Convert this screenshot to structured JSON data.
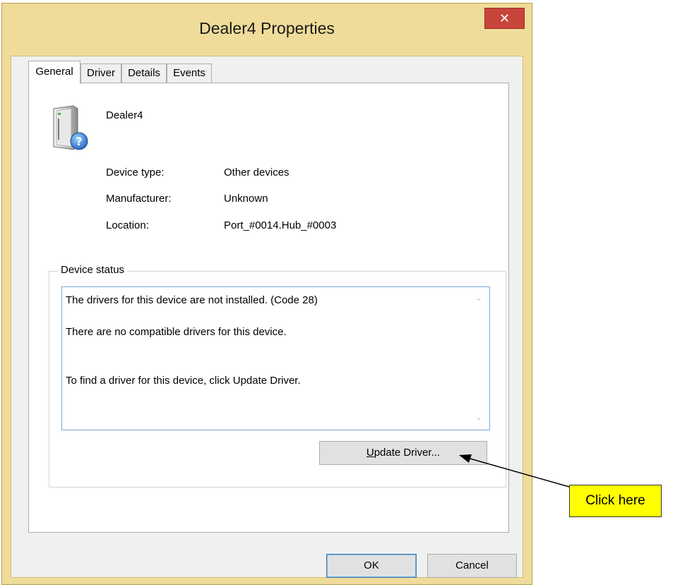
{
  "window": {
    "title": "Dealer4 Properties",
    "close_symbol": "✕"
  },
  "tabs": [
    {
      "label": "General",
      "active": true
    },
    {
      "label": "Driver",
      "active": false
    },
    {
      "label": "Details",
      "active": false
    },
    {
      "label": "Events",
      "active": false
    }
  ],
  "device": {
    "icon": "unknown-device-icon",
    "name": "Dealer4"
  },
  "properties": [
    {
      "label": "Device type:",
      "value": "Other devices"
    },
    {
      "label": "Manufacturer:",
      "value": "Unknown"
    },
    {
      "label": "Location:",
      "value": "Port_#0014.Hub_#0003"
    }
  ],
  "device_status": {
    "legend": "Device status",
    "lines": [
      "The drivers for this device are not installed. (Code 28)",
      "There are no compatible drivers for this device.",
      "To find a driver for this device, click Update Driver."
    ]
  },
  "buttons": {
    "update_driver_prefix": "",
    "update_driver_accel": "U",
    "update_driver_rest": "pdate Driver...",
    "ok": "OK",
    "cancel": "Cancel"
  },
  "annotation": {
    "callout_text": "Click here",
    "callout_color": "#ffff00"
  }
}
